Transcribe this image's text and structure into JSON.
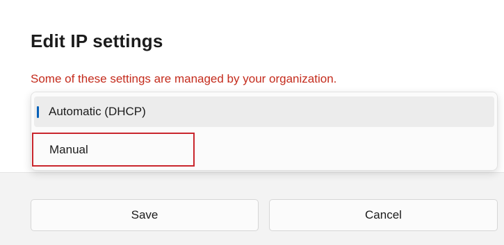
{
  "dialog": {
    "title": "Edit IP settings",
    "warning": "Some of these settings are managed by your organization.",
    "warning_color": "#c42b1c"
  },
  "dropdown": {
    "options": [
      {
        "label": "Automatic (DHCP)",
        "selected": true
      },
      {
        "label": "Manual",
        "selected": false
      }
    ],
    "accent_color": "#005fb8"
  },
  "actions": {
    "save_label": "Save",
    "cancel_label": "Cancel"
  },
  "annotation": {
    "highlight_color": "#c9252c"
  }
}
